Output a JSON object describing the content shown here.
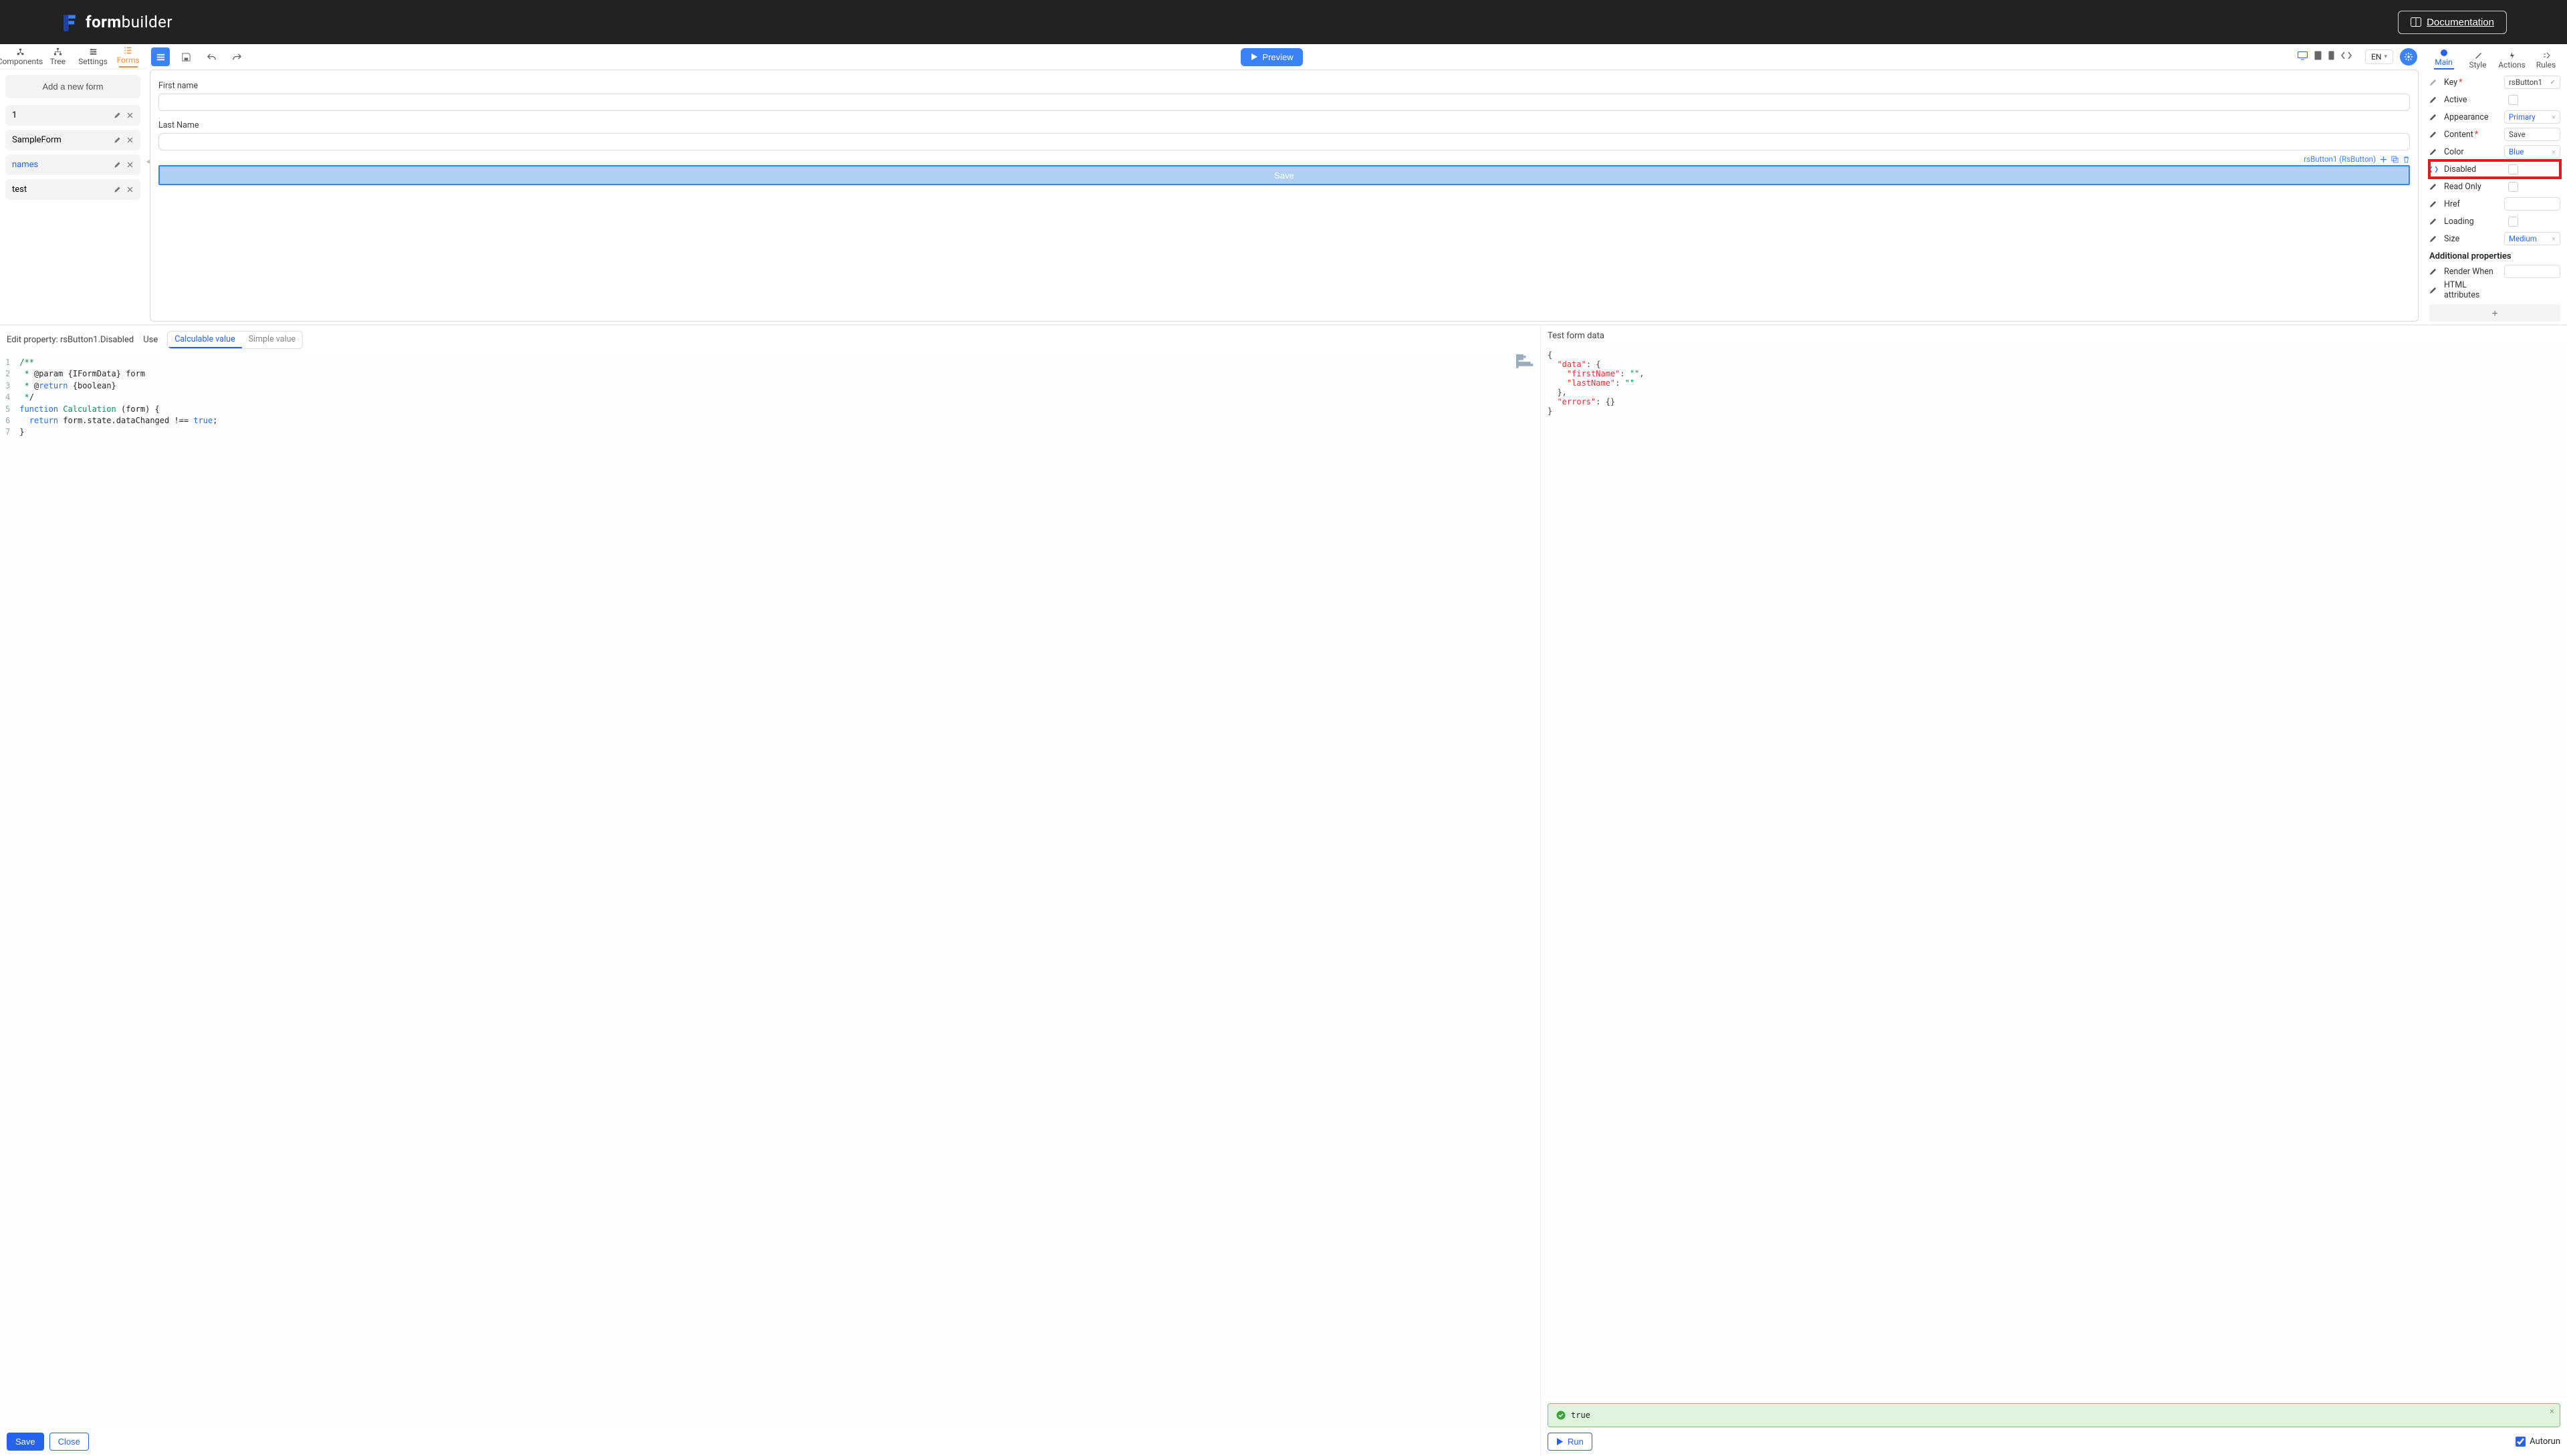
{
  "header": {
    "brand_bold": "form",
    "brand_rest": "builder",
    "documentation": "Documentation"
  },
  "leftTabs": {
    "components": "Components",
    "tree": "Tree",
    "settings": "Settings",
    "forms": "Forms"
  },
  "formsPanel": {
    "addNew": "Add a new form",
    "items": [
      {
        "name": "1",
        "active": false
      },
      {
        "name": "SampleForm",
        "active": false
      },
      {
        "name": "names",
        "active": true
      },
      {
        "name": "test",
        "active": false
      }
    ]
  },
  "toolbar": {
    "preview": "Preview",
    "lang": "EN"
  },
  "canvas": {
    "field1_label": "First name",
    "field2_label": "Last Name",
    "selected_component": "rsButton1 (RsButton)",
    "save_label": "Save"
  },
  "rightTabs": {
    "main": "Main",
    "style": "Style",
    "actions": "Actions",
    "rules": "Rules"
  },
  "props": {
    "key_label": "Key",
    "key_value": "rsButton1",
    "active_label": "Active",
    "appearance_label": "Appearance",
    "appearance_value": "Primary",
    "content_label": "Content",
    "content_value": "Save",
    "color_label": "Color",
    "color_value": "Blue",
    "disabled_label": "Disabled",
    "readonly_label": "Read Only",
    "href_label": "Href",
    "loading_label": "Loading",
    "size_label": "Size",
    "size_value": "Medium",
    "additional_title": "Additional properties",
    "renderwhen_label": "Render When",
    "htmlattrs_label": "HTML attributes"
  },
  "editor": {
    "title_prefix": "Edit property: ",
    "title_prop": "rsButton1.Disabled",
    "use_label": "Use",
    "tab_calc": "Calculable value",
    "tab_simple": "Simple value",
    "save": "Save",
    "close": "Close",
    "run": "Run",
    "autorun": "Autorun",
    "code_lines": [
      "/**",
      " * @param {IFormData} form",
      " * @return {boolean}",
      " */",
      "function Calculation (form) {",
      "  return form.state.dataChanged !== true;",
      "}"
    ]
  },
  "testData": {
    "title": "Test form data",
    "result_value": "true",
    "json": {
      "data": {
        "firstName": "",
        "lastName": ""
      },
      "errors": {}
    }
  }
}
